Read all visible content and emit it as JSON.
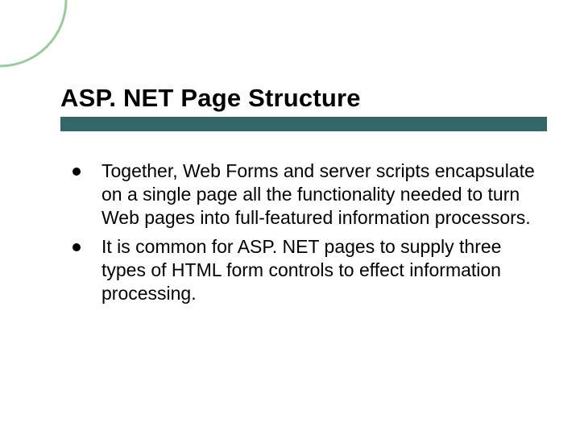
{
  "colors": {
    "accent": "#336666",
    "arc": "#99CC99"
  },
  "slide": {
    "title": "ASP. NET Page Structure",
    "bullets": [
      "Together, Web Forms and server scripts encapsulate on a single page all the functionality needed to turn Web pages into full-featured information processors.",
      "It is common for ASP. NET pages to supply three types of HTML form controls to effect information processing."
    ]
  }
}
